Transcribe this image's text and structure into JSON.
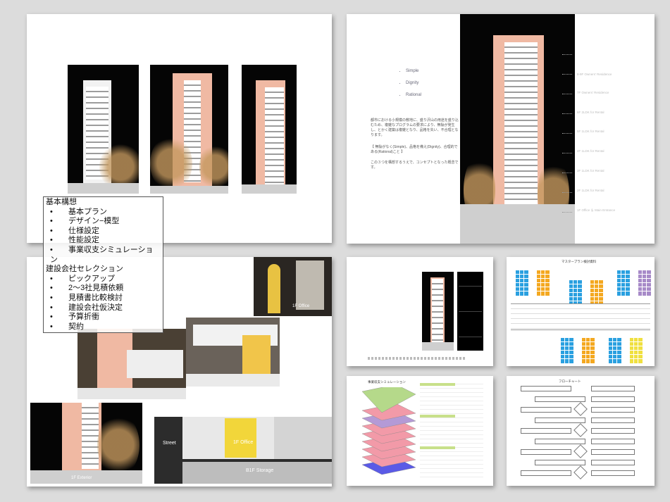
{
  "slide1": {
    "overlay": {
      "heading1": "基本構想",
      "items1": [
        "基本プラン",
        "デザイン−模型",
        "仕様設定",
        "性能設定",
        "事業収支シミュレーション"
      ],
      "heading2": "建設会社セレクション",
      "items2": [
        "ピックアップ",
        "2〜3社見積依頼",
        "見積書比較検討",
        "建設会社仮決定",
        "予算折衝",
        "契約"
      ],
      "bullet": "•"
    }
  },
  "slide2": {
    "keywords": [
      "Simple",
      "Dignity",
      "Rational"
    ],
    "paragraph1": "都市における小規模の敷地に、盛り沢山の用途を盛り込むため、複雑なプログラムの要求により、無駄が発生し、とかく建築は複雑となり、品格を失い、不合理となります。",
    "paragraph2": "【 無駄がなく(Simple)、品格を備え(Dignity)、合理的である(Rational)こと 】",
    "paragraph3": "この３つを構想するうえで、コンセプトとなった概念です。",
    "floor_labels": [
      "8-9F Owners' Residence",
      "7F Owners' Residence",
      "6F 2LDK for Rental",
      "5F 1LDK for Rental",
      "4F 1LDK for Rental",
      "3F 1LDK for Rental",
      "2F 1LDK for Rental",
      "1F Office ＆ Main Entrance"
    ]
  },
  "slide3": {
    "captions": {
      "office": "1F Office",
      "exterior": "1F  Exterior",
      "street": "Street",
      "office2": "1F Office",
      "storage": "B1F Storage"
    }
  },
  "slide5": {
    "title": "マスタープラン検討資料"
  },
  "slide6": {
    "title": "事業収支シミュレーション"
  },
  "slide7": {
    "title": "フローチャート"
  },
  "colors": {
    "background": "#dcdcdc",
    "facade_pink": "#f0b9a3",
    "grid_blue": "#2aa0e0",
    "grid_orange": "#f4a820",
    "grid_purple": "#a78ac8",
    "grid_yellow": "#f0e040",
    "floor_green": "#b5d98a",
    "floor_pink": "#f29aa8",
    "floor_purple": "#b49ad6",
    "floor_blue": "#5a5ae6"
  }
}
